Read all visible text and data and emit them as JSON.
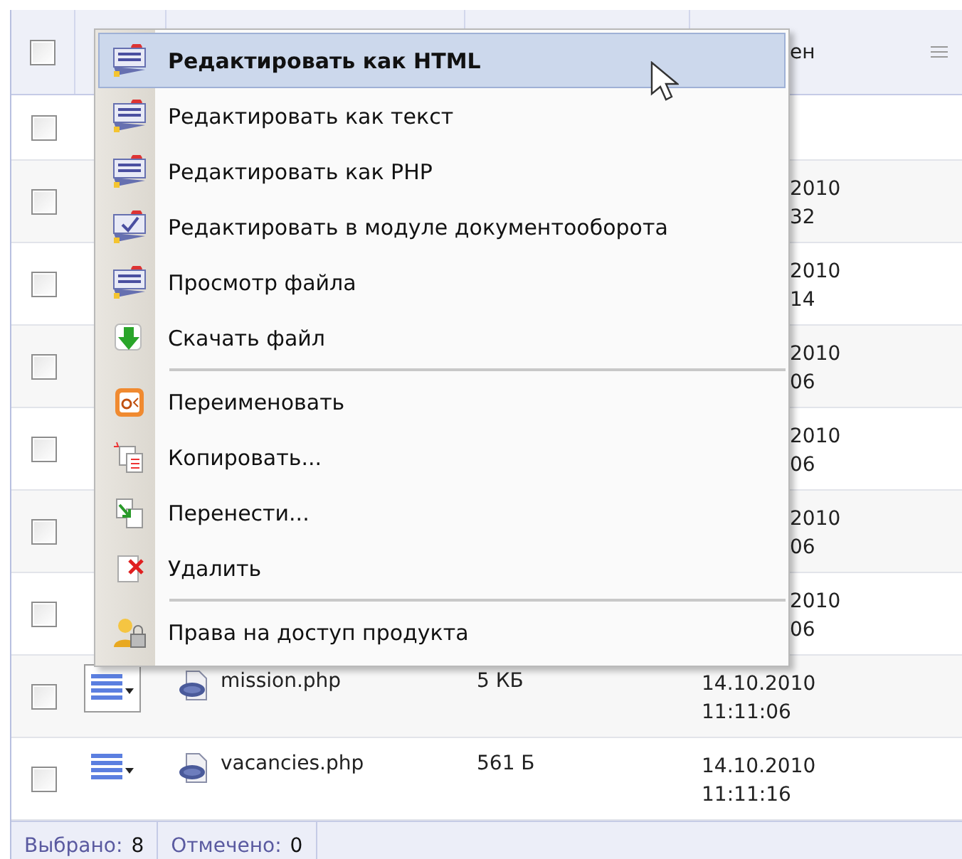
{
  "table": {
    "header": {
      "checked": false,
      "date_fragment": "ен"
    },
    "rows": [
      {
        "kind": "covered",
        "checked": false,
        "date": []
      },
      {
        "kind": "covered",
        "checked": false,
        "date": [
          "2010",
          "32"
        ]
      },
      {
        "kind": "covered",
        "checked": false,
        "date": [
          "2010",
          "14"
        ]
      },
      {
        "kind": "covered",
        "checked": false,
        "date": [
          "2010",
          "06"
        ]
      },
      {
        "kind": "covered",
        "checked": false,
        "date": [
          "2010",
          "06"
        ]
      },
      {
        "kind": "covered",
        "checked": false,
        "date": [
          "2010",
          "06"
        ]
      },
      {
        "kind": "covered",
        "checked": false,
        "date": [
          "2010",
          "06"
        ]
      },
      {
        "kind": "file",
        "checked": false,
        "menu_open": true,
        "name": "mission.php",
        "size": "5 КБ",
        "date": [
          "14.10.2010",
          "11:11:06"
        ]
      },
      {
        "kind": "file",
        "checked": false,
        "menu_open": false,
        "name": "vacancies.php",
        "size": "561 Б",
        "date": [
          "14.10.2010",
          "11:11:16"
        ]
      }
    ]
  },
  "status_bar": [
    {
      "label": "Выбрано:",
      "value": "8"
    },
    {
      "label": "Отмечено:",
      "value": "0"
    }
  ],
  "menu": {
    "groups": [
      [
        {
          "label": "Редактировать как HTML",
          "selected": true
        },
        {
          "label": "Редактировать как текст",
          "selected": false
        },
        {
          "label": "Редактировать как PHP",
          "selected": false
        },
        {
          "label": "Редактировать в модуле документооборота",
          "selected": false
        },
        {
          "label": "Просмотр файла",
          "selected": false
        },
        {
          "label": "Скачать файл",
          "selected": false
        }
      ],
      [
        {
          "label": "Переименовать",
          "selected": false
        },
        {
          "label": "Копировать...",
          "selected": false
        },
        {
          "label": "Перенести...",
          "selected": false
        },
        {
          "label": "Удалить",
          "selected": false
        }
      ],
      [
        {
          "label": "Права на доступ продукта",
          "selected": false
        }
      ]
    ]
  }
}
